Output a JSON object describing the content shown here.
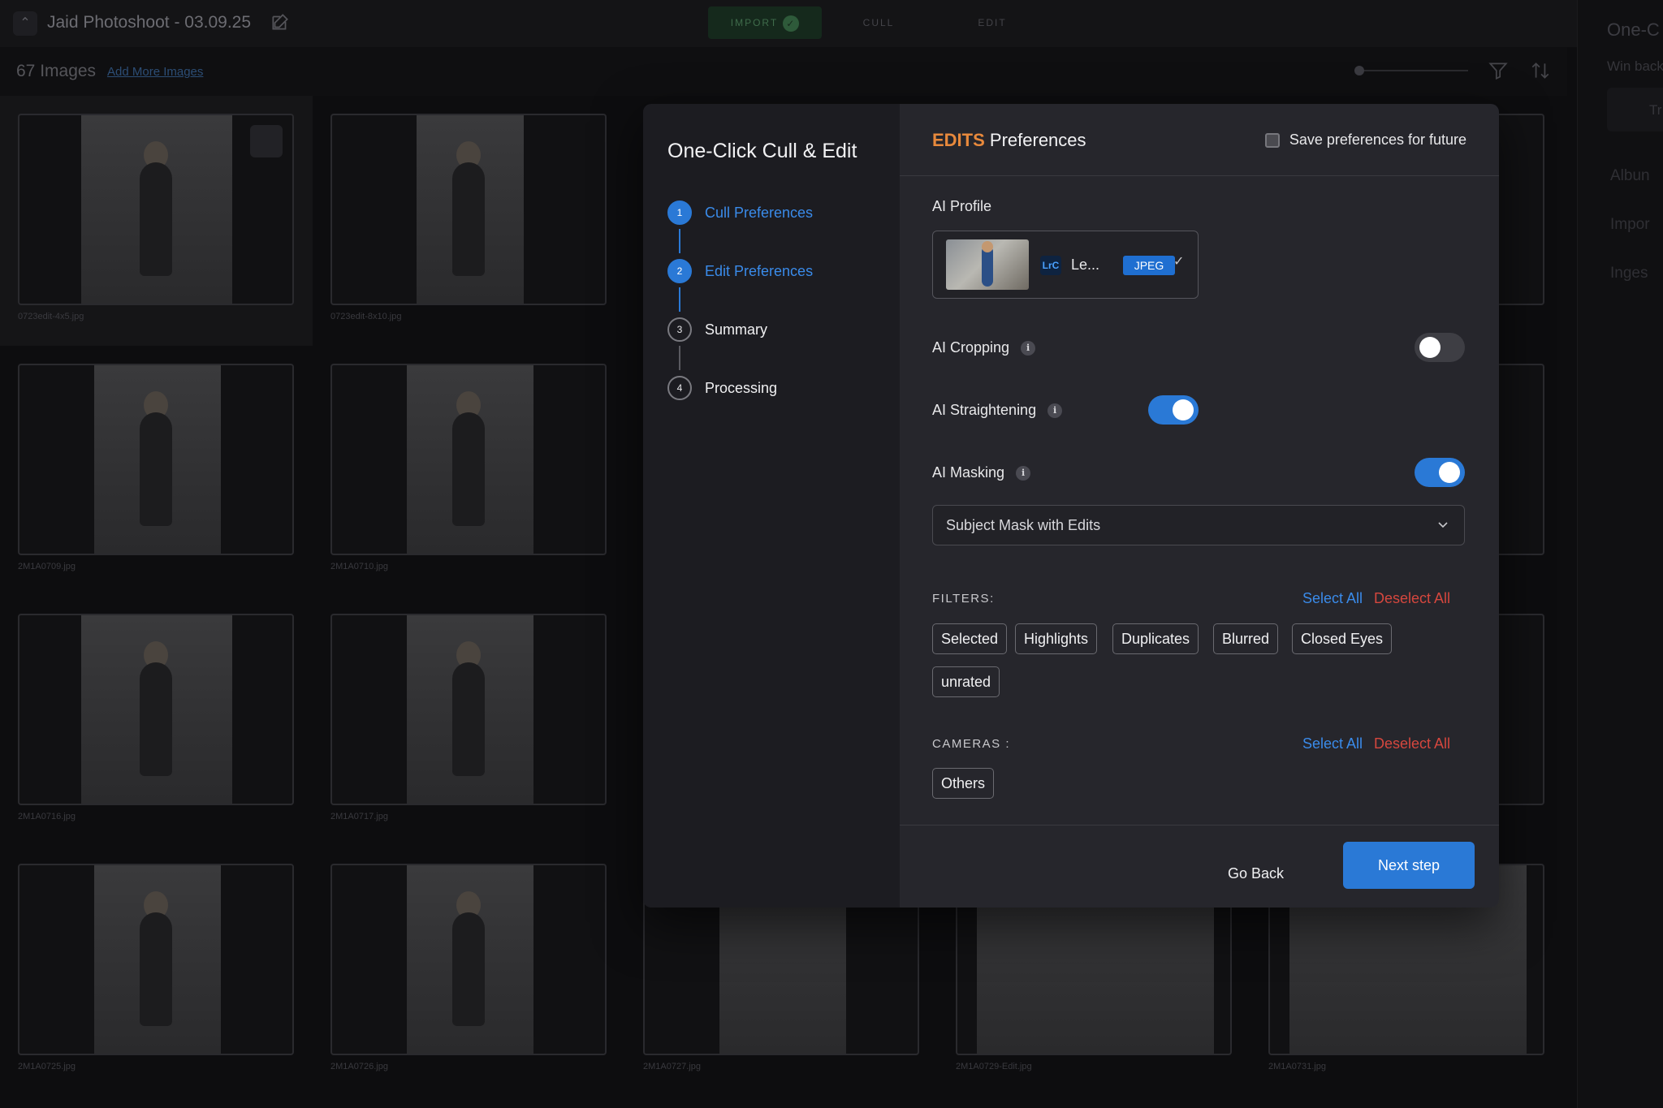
{
  "topbar": {
    "back_icon": "chevron-up-icon",
    "project_title": "Jaid Photoshoot - 03.09.25",
    "edit_icon": "pencil-square-icon",
    "stages": [
      {
        "label": "IMPORT",
        "done": true
      },
      {
        "label": "CULL",
        "done": false
      },
      {
        "label": "EDIT",
        "done": false
      }
    ]
  },
  "subbar": {
    "image_count": "67 Images",
    "add_more": "Add More Images",
    "filter_icon": "filter-icon",
    "sort_icon": "sort-arrows-icon"
  },
  "grid": {
    "files": [
      "0723edit-4x5.jpg",
      "0723edit-8x10.jpg",
      "2M1A0709.jpg",
      "2M1A0710.jpg",
      "2M1A0716.jpg",
      "2M1A0717.jpg",
      "2M1A0725.jpg",
      "2M1A0726.jpg",
      "2M1A0727.jpg",
      "2M1A0729-Edit.jpg",
      "2M1A0731.jpg"
    ]
  },
  "right_panel": {
    "title": "One-C",
    "subtitle": "Win back",
    "box_text": "Tr",
    "items": [
      "Albun",
      "Impor",
      "Inges"
    ]
  },
  "modal": {
    "title": "One-Click Cull & Edit",
    "steps": [
      {
        "num": "1",
        "label": "Cull Preferences",
        "done": true
      },
      {
        "num": "2",
        "label": "Edit Preferences",
        "done": true
      },
      {
        "num": "3",
        "label": "Summary",
        "done": false
      },
      {
        "num": "4",
        "label": "Processing",
        "done": false
      }
    ],
    "heading_accent": "EDITS",
    "heading_rest": " Preferences",
    "save_pref_label": "Save preferences for future",
    "save_pref_checked": false,
    "ai_profile_label": "AI Profile",
    "profile": {
      "app_badge": "LrC",
      "name": "Le...",
      "format": "JPEG"
    },
    "ai_cropping": {
      "label": "AI Cropping",
      "enabled": false
    },
    "ai_straightening": {
      "label": "AI Straightening",
      "enabled": true
    },
    "ai_masking": {
      "label": "AI Masking",
      "enabled": true
    },
    "mask_select": {
      "value": "Subject Mask with Edits"
    },
    "filters": {
      "label": "FILTERS:",
      "select_all": "Select All",
      "deselect_all": "Deselect All",
      "chips": [
        "Selected",
        "Highlights",
        "Duplicates",
        "Blurred",
        "Closed Eyes",
        "unrated"
      ]
    },
    "cameras": {
      "label": "CAMERAS :",
      "select_all": "Select All",
      "deselect_all": "Deselect All",
      "chips": [
        "Others"
      ]
    },
    "footer": {
      "go_back": "Go Back",
      "next_step": "Next step"
    },
    "colors": {
      "accent_orange": "#e8893c",
      "primary_blue": "#2a79d6",
      "danger_red": "#d5473e"
    }
  }
}
